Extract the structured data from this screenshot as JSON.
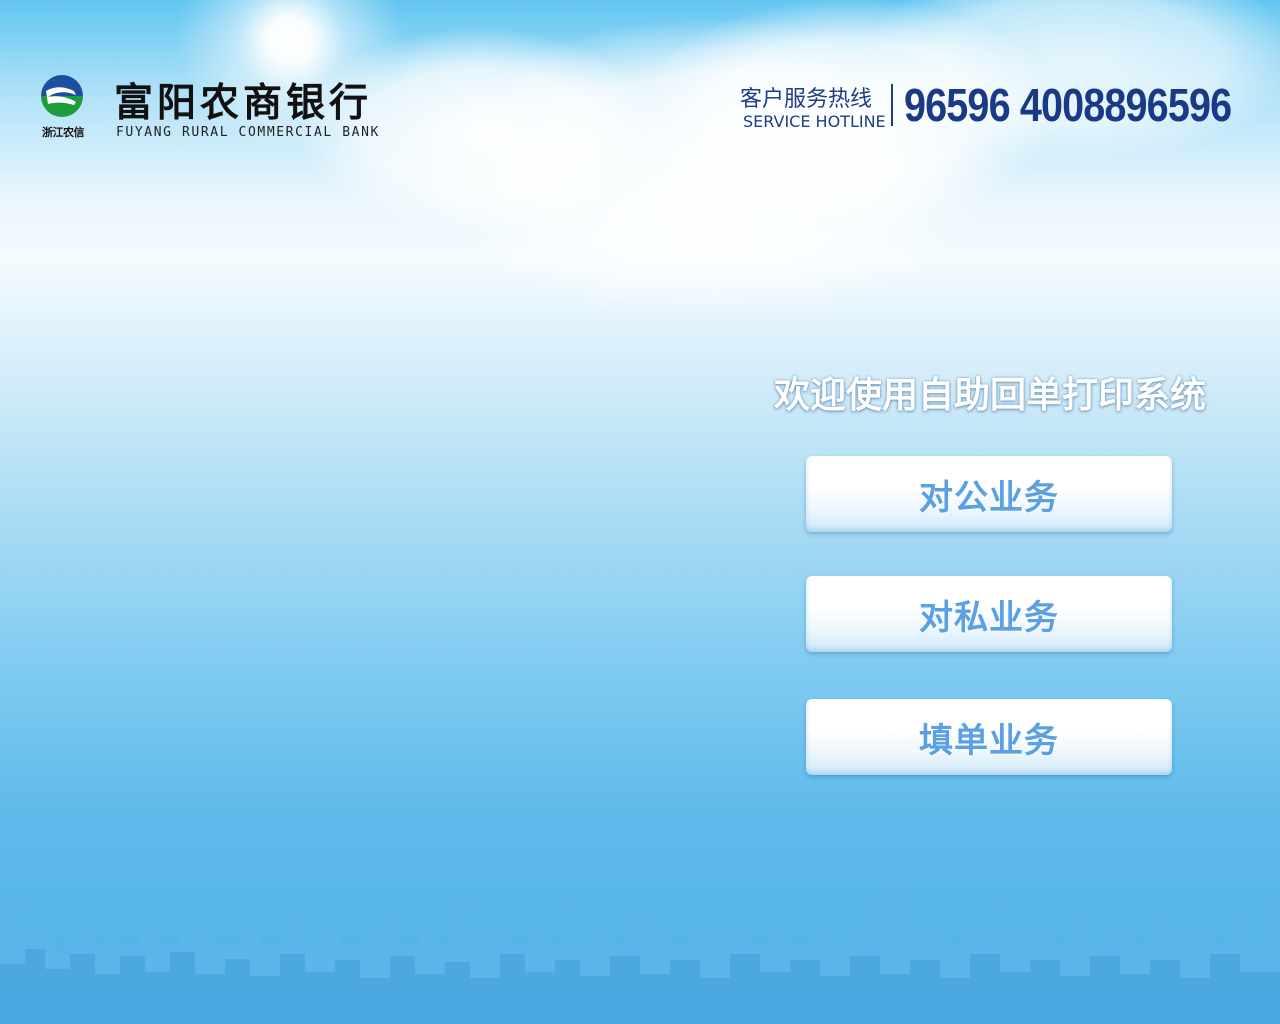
{
  "header": {
    "logo_text": "浙江农信",
    "bank_name_cn": "富阳农商银行",
    "bank_name_en": "FUYANG RURAL COMMERCIAL BANK",
    "hotline_label_cn": "客户服务热线",
    "hotline_label_en": "SERVICE HOTLINE",
    "hotline_numbers": "96596 4008896596"
  },
  "main": {
    "welcome_text": "欢迎使用自助回单打印系统",
    "buttons": [
      {
        "label": "对公业务"
      },
      {
        "label": "对私业务"
      },
      {
        "label": "填单业务"
      }
    ]
  },
  "colors": {
    "brand_navy": "#1f3c86",
    "button_text": "#5aa0e3",
    "logo_blue": "#1c4fa0",
    "logo_green": "#1e9b3c"
  },
  "icons": {
    "logo": "zhejiang-rural-credit-logo",
    "background": "sky-clouds-city-skyline"
  }
}
